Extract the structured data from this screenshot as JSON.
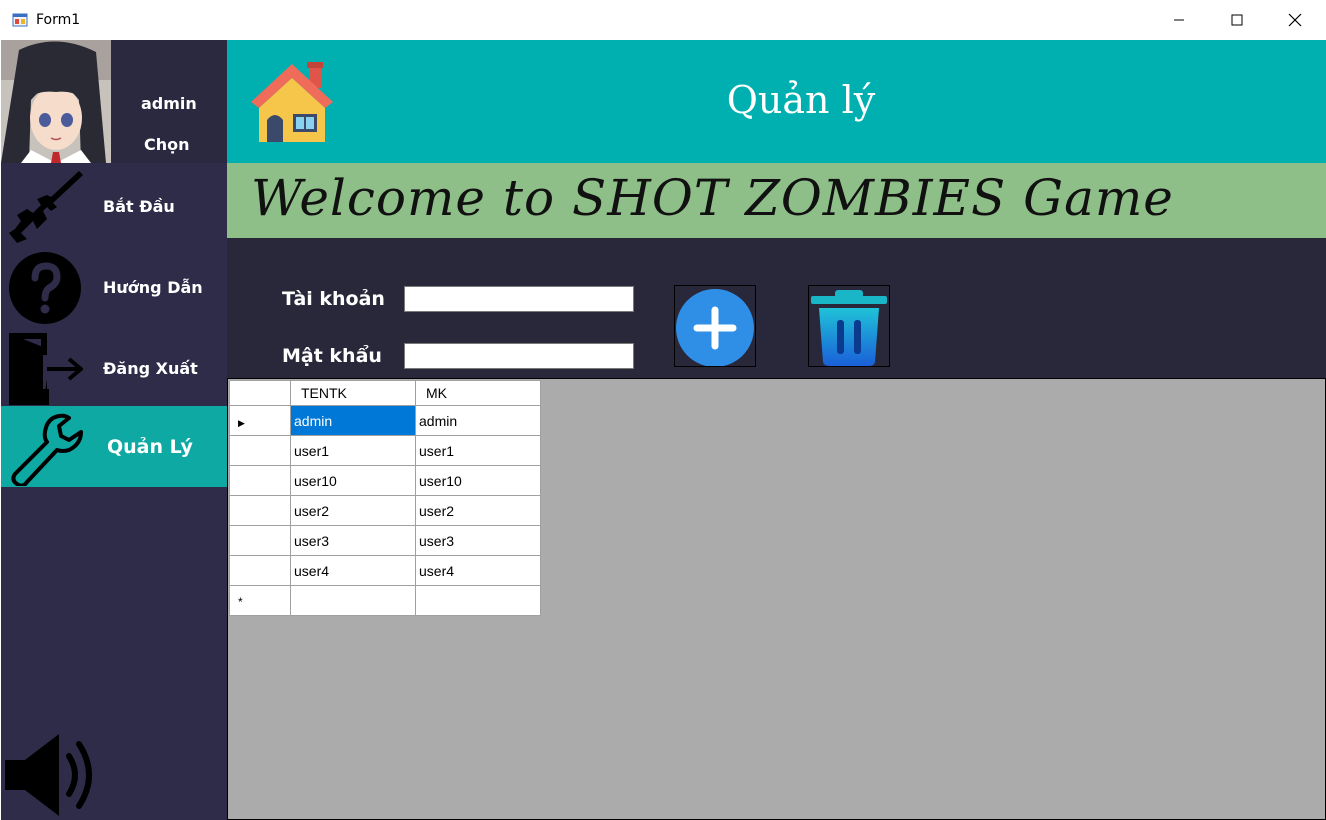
{
  "window": {
    "title": "Form1"
  },
  "sidebar": {
    "username": "admin",
    "choose_label": "Chọn",
    "items": [
      {
        "label": "Bắt Đầu",
        "icon": "rifle-icon"
      },
      {
        "label": "Hướng Dẫn",
        "icon": "question-icon"
      },
      {
        "label": "Đăng Xuất",
        "icon": "logout-icon"
      },
      {
        "label": "Quản Lý",
        "icon": "wrench-icon",
        "active": true
      }
    ],
    "sound_icon": "speaker-icon"
  },
  "header": {
    "title": "Quản lý",
    "icon": "home-icon"
  },
  "banner": {
    "text": "Welcome to SHOT ZOMBIES Game"
  },
  "form": {
    "account_label": "Tài khoản",
    "account_value": "",
    "password_label": "Mật khẩu",
    "password_value": "",
    "add_icon": "plus-circle-icon",
    "delete_icon": "trash-icon"
  },
  "grid": {
    "columns": [
      "TENTK",
      "MK"
    ],
    "rows": [
      [
        "admin",
        "admin"
      ],
      [
        "user1",
        "user1"
      ],
      [
        "user10",
        "user10"
      ],
      [
        "user2",
        "user2"
      ],
      [
        "user3",
        "user3"
      ],
      [
        "user4",
        "user4"
      ]
    ],
    "current_row_marker": "▶",
    "new_row_marker": "*"
  },
  "colors": {
    "sidebar": "#2e2c48",
    "accent": "#00b0b0",
    "banner": "#8fbf88",
    "form_bg": "#28283a",
    "grid_bg": "#ababab",
    "selection": "#0078d7"
  }
}
